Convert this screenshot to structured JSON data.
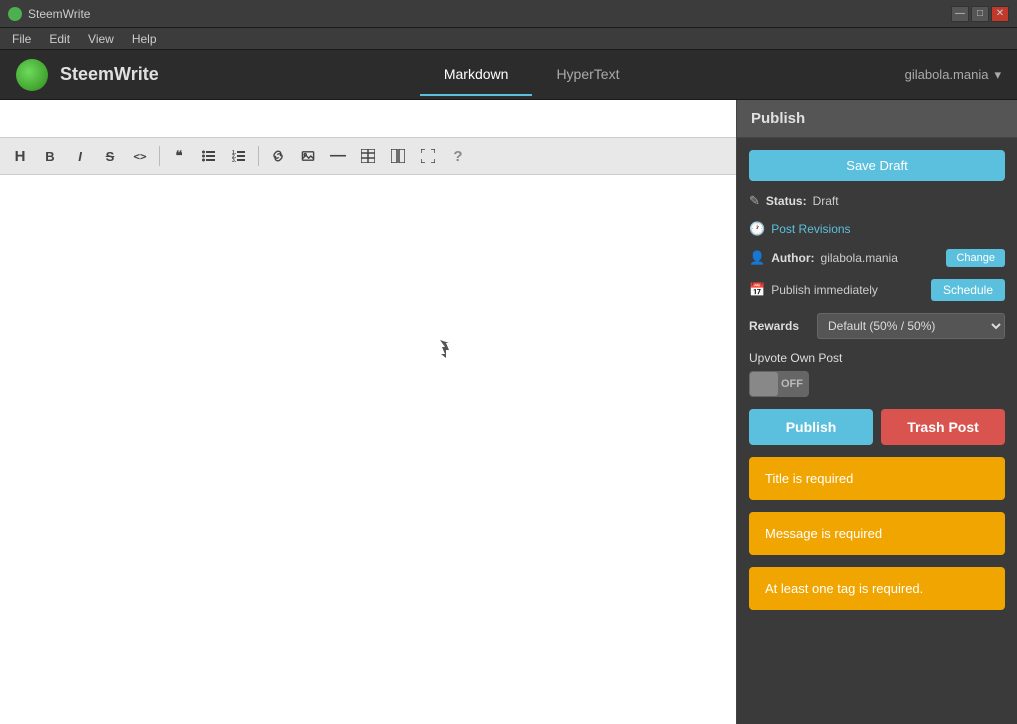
{
  "titleBar": {
    "appName": "SteemWrite",
    "controls": {
      "minimize": "—",
      "maximize": "□",
      "close": "✕"
    }
  },
  "menuBar": {
    "items": [
      "File",
      "Edit",
      "View",
      "Help"
    ]
  },
  "appHeader": {
    "title": "SteemWrite",
    "tabs": [
      {
        "id": "markdown",
        "label": "Markdown",
        "active": true
      },
      {
        "id": "hypertext",
        "label": "HyperText",
        "active": false
      }
    ],
    "user": "gilabola.mania"
  },
  "editor": {
    "titlePlaceholder": "",
    "titleValue": ""
  },
  "toolbar": {
    "buttons": [
      {
        "id": "heading",
        "symbol": "H",
        "title": "Heading"
      },
      {
        "id": "bold",
        "symbol": "B",
        "title": "Bold"
      },
      {
        "id": "italic",
        "symbol": "I",
        "title": "Italic"
      },
      {
        "id": "strikethrough",
        "symbol": "S̶",
        "title": "Strikethrough"
      },
      {
        "id": "code",
        "symbol": "<>",
        "title": "Code"
      },
      {
        "id": "blockquote",
        "symbol": "❝",
        "title": "Blockquote"
      },
      {
        "id": "unordered-list",
        "symbol": "≡",
        "title": "Unordered List"
      },
      {
        "id": "ordered-list",
        "symbol": "☰",
        "title": "Ordered List"
      },
      {
        "id": "link",
        "symbol": "🔗",
        "title": "Link"
      },
      {
        "id": "image",
        "symbol": "🖼",
        "title": "Image"
      },
      {
        "id": "divider",
        "symbol": "—",
        "title": "Horizontal Rule"
      },
      {
        "id": "table",
        "symbol": "⊞",
        "title": "Table"
      },
      {
        "id": "columns",
        "symbol": "⊟",
        "title": "Columns"
      },
      {
        "id": "fullscreen",
        "symbol": "⛶",
        "title": "Fullscreen"
      },
      {
        "id": "help",
        "symbol": "?",
        "title": "Help"
      }
    ]
  },
  "sidebar": {
    "header": "Publish",
    "saveDraftLabel": "Save Draft",
    "status": {
      "label": "Status:",
      "value": "Draft"
    },
    "postRevisions": {
      "label": "Post Revisions"
    },
    "author": {
      "label": "Author:",
      "value": "gilabola.mania",
      "changeLabel": "Change"
    },
    "publish": {
      "label": "Publish immediately",
      "scheduleLabel": "Schedule"
    },
    "rewards": {
      "label": "Rewards",
      "defaultValue": "Default (50% / 50%)"
    },
    "upvoteOwnPost": {
      "label": "Upvote Own Post",
      "toggleState": "OFF"
    },
    "publishBtn": "Publish",
    "trashBtn": "Trash Post",
    "alerts": [
      {
        "id": "title-required",
        "message": "Title is required"
      },
      {
        "id": "message-required",
        "message": "Message is required"
      },
      {
        "id": "tag-required",
        "message": "At least one tag is required."
      }
    ]
  }
}
